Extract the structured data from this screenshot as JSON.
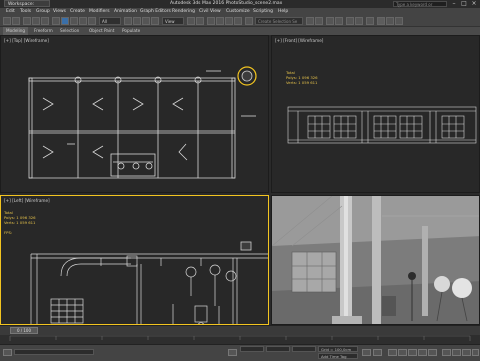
{
  "titlebar": {
    "workspace": "Workspace: Default",
    "title": "Autodesk 3ds Max 2016      PhotoStudio_scene2.max",
    "search_placeholder": "Type a keyword or phrase"
  },
  "menu": [
    "Edit",
    "Tools",
    "Group",
    "Views",
    "Create",
    "Modifiers",
    "Animation",
    "Graph Editors",
    "Rendering",
    "Civil View",
    "Customize",
    "Scripting",
    "Help"
  ],
  "toolbar": {
    "filter_value": "All",
    "view_value": "View",
    "selection_set_placeholder": "Create Selection Se"
  },
  "ribbon": [
    "Modeling",
    "Freeform",
    "Selection",
    "Object Paint",
    "Populate"
  ],
  "viewports": {
    "top": {
      "label": "[+] [Top] [Wireframe]"
    },
    "front": {
      "label": "[+] [Front] [Wireframe]",
      "stats": [
        "Total",
        "Polys:  1 096 326",
        "Verts:  1 059 611"
      ]
    },
    "left": {
      "label": "[+] [Left] [Wireframe]",
      "stats": [
        "Total",
        "Polys:  1 096 326",
        "Verts:  1 059 611",
        "",
        "FPS:"
      ]
    },
    "persp": {
      "label": "[+] [Perspective] [Realistic]"
    }
  },
  "timeline": {
    "frame": "0 / 100"
  },
  "statusbar": {
    "grid": "Grid = 100,0cm",
    "add_time_tag": "Add Time Tag"
  },
  "colors": {
    "active_border": "#f2c420",
    "stats_text": "#e6c24a",
    "wire": "#d8d8d8",
    "background": "#282828"
  }
}
